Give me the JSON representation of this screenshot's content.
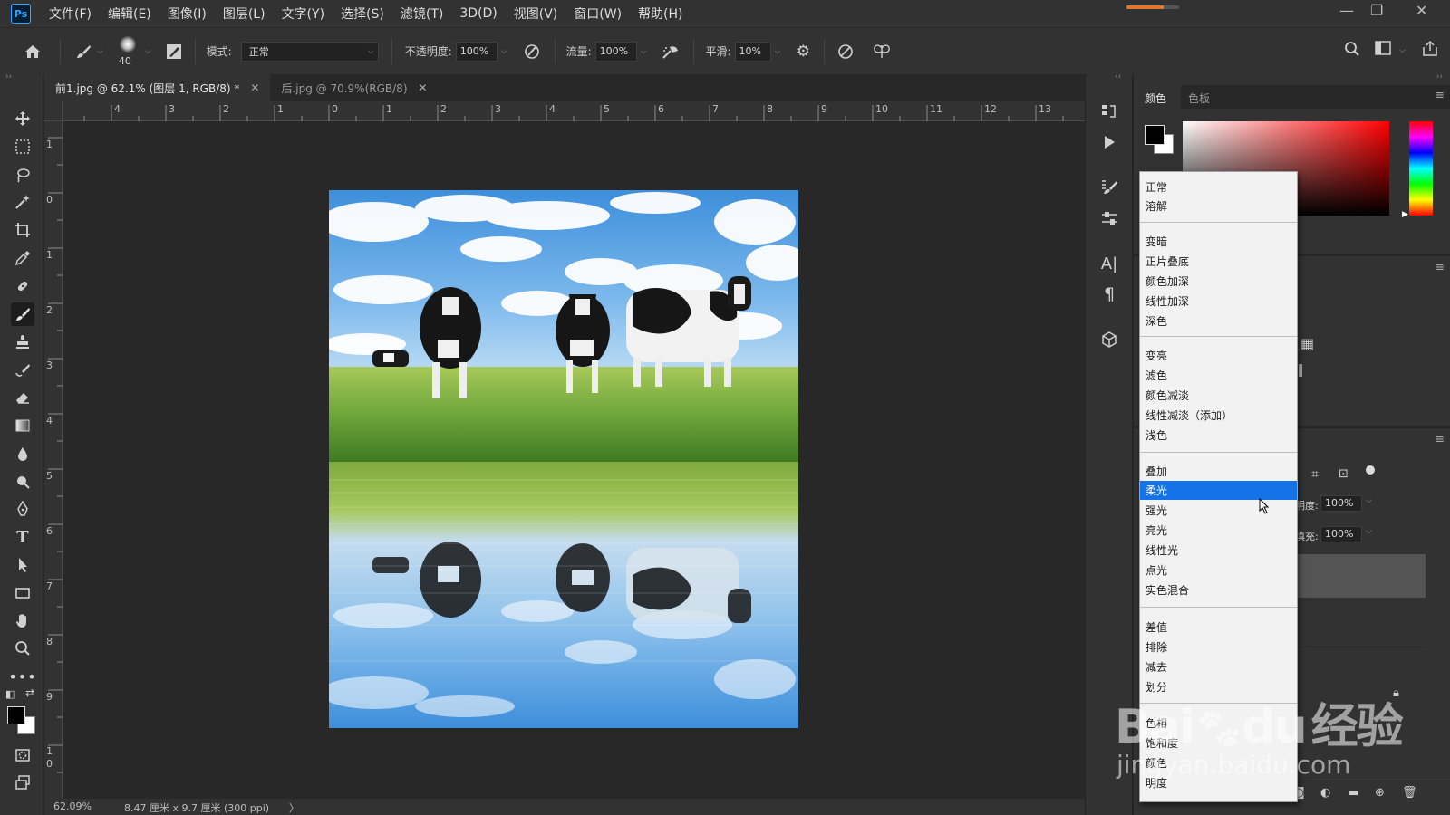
{
  "app": {
    "logo": "Ps",
    "menu": [
      "文件(F)",
      "编辑(E)",
      "图像(I)",
      "图层(L)",
      "文字(Y)",
      "选择(S)",
      "滤镜(T)",
      "3D(D)",
      "视图(V)",
      "窗口(W)",
      "帮助(H)"
    ],
    "window_controls": [
      "minimize-icon",
      "restore-icon",
      "close-icon"
    ]
  },
  "options": {
    "brush_size": "40",
    "mode_label": "模式:",
    "mode_value": "正常",
    "opacity_label": "不透明度:",
    "opacity_value": "100%",
    "flow_label": "流量:",
    "flow_value": "100%",
    "smooth_label": "平滑:",
    "smooth_value": "10%"
  },
  "tabs": [
    {
      "label": "前1.jpg @ 62.1% (图层 1, RGB/8) *",
      "active": true
    },
    {
      "label": "后.jpg @ 70.9%(RGB/8)",
      "active": false
    }
  ],
  "ruler": {
    "top": [
      "4",
      "3",
      "2",
      "1",
      "0",
      "1",
      "2",
      "3",
      "4",
      "5",
      "6",
      "7",
      "8",
      "9",
      "10",
      "11",
      "12",
      "13"
    ],
    "left": [
      "1",
      "0",
      "1",
      "2",
      "3",
      "4",
      "5",
      "6",
      "7",
      "8",
      "9",
      "1",
      "0"
    ]
  },
  "status": {
    "zoom": "62.09%",
    "doc_size": "8.47 厘米 x 9.7 厘米 (300 ppi)",
    "arrow": "〉"
  },
  "panels": {
    "color_tab": "颜色",
    "swatches_tab": "色板",
    "opacity_label": "明度:",
    "opacity_value": "100%",
    "fill_label": "填充:",
    "fill_value": "100%"
  },
  "blend_modes": {
    "groups": [
      [
        "正常",
        "溶解"
      ],
      [
        "变暗",
        "正片叠底",
        "颜色加深",
        "线性加深",
        "深色"
      ],
      [
        "变亮",
        "滤色",
        "颜色减淡",
        "线性减淡（添加）",
        "浅色"
      ],
      [
        "叠加",
        "柔光",
        "强光",
        "亮光",
        "线性光",
        "点光",
        "实色混合"
      ],
      [
        "差值",
        "排除",
        "减去",
        "划分"
      ],
      [
        "色相",
        "饱和度",
        "颜色",
        "明度"
      ]
    ],
    "selected": "柔光"
  },
  "watermark": {
    "line1": "Bai",
    "line1b": "du",
    "line1c": "经验",
    "line2": "jingyan.baidu.com"
  },
  "colors": {
    "accent": "#1473e6",
    "foreground": "#000000",
    "background": "#ffffff"
  }
}
